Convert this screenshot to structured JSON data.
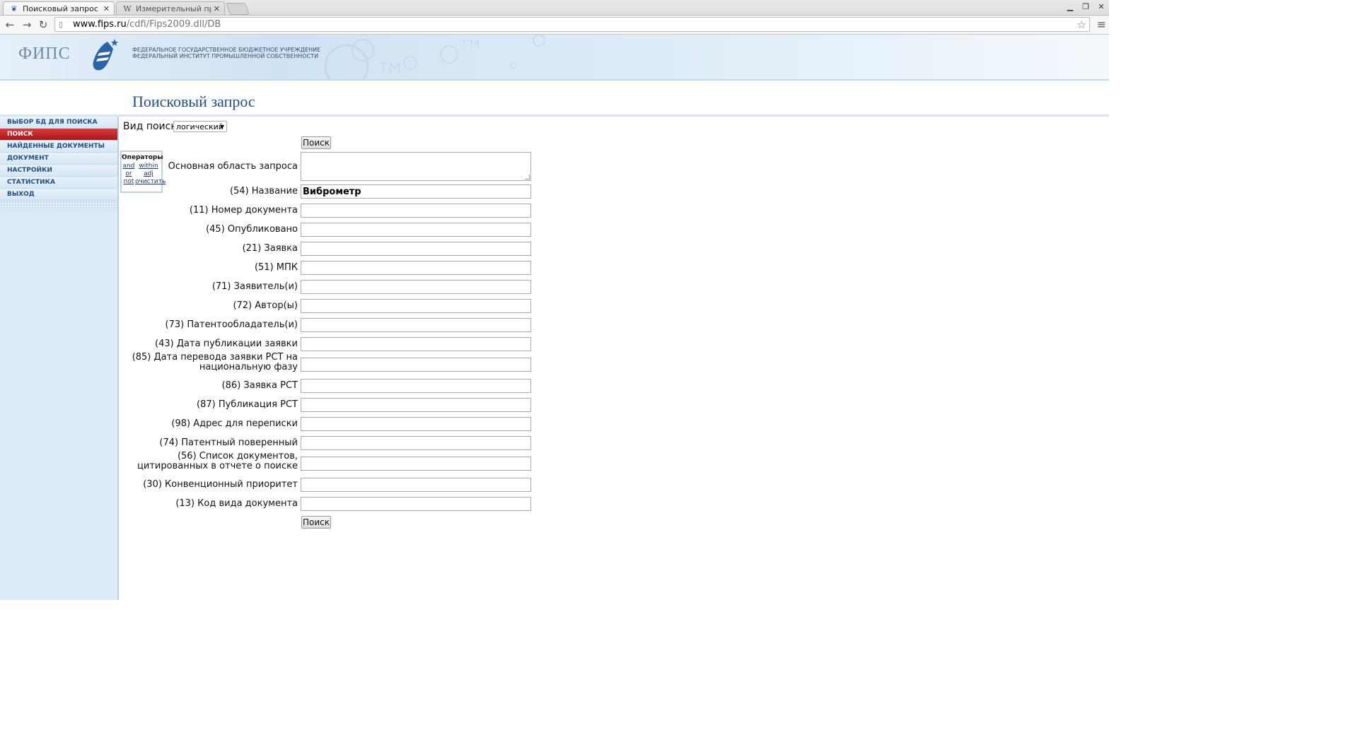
{
  "browser": {
    "tabs": [
      {
        "title": "Поисковый запрос",
        "favicon": "fips-icon",
        "active": true
      },
      {
        "title": "Измерительный прибор",
        "favicon": "W",
        "active": false
      }
    ],
    "url_host": "www.fips.ru",
    "url_path": "/cdfi/Fips2009.dll/DB"
  },
  "header": {
    "logo_text": "ФИПС",
    "org_line1": "ФЕДЕРАЛЬНОЕ ГОСУДАРСТВЕННОЕ БЮДЖЕТНОЕ УЧРЕЖДЕНИЕ",
    "org_line2": "ФЕДЕРАЛЬНЫЙ ИНСТИТУТ ПРОМЫШЛЕННОЙ СОБСТВЕННОСТИ",
    "page_title": "Поисковый запрос"
  },
  "sidebar": {
    "items": [
      {
        "label": "ВЫБОР БД ДЛЯ ПОИСКА",
        "active": false
      },
      {
        "label": "ПОИСК",
        "active": true
      },
      {
        "label": "НАЙДЕННЫЕ ДОКУМЕНТЫ",
        "active": false
      },
      {
        "label": "ДОКУМЕНТ",
        "active": false
      },
      {
        "label": "НАСТРОЙКИ",
        "active": false
      },
      {
        "label": "СТАТИСТИКА",
        "active": false
      },
      {
        "label": "ВЫХОД",
        "active": false
      }
    ]
  },
  "search": {
    "type_label": "Вид поиска",
    "type_value": "логический",
    "button_label": "Поиск",
    "operators": {
      "title": "Операторы",
      "items": [
        "and",
        "within",
        "or",
        "adj",
        "not",
        "очистить"
      ]
    },
    "main_area_label": "Основная область запроса",
    "fields": [
      {
        "label": "(54) Название",
        "value": "Виброметр"
      },
      {
        "label": "(11) Номер документа",
        "value": ""
      },
      {
        "label": "(45) Опубликовано",
        "value": ""
      },
      {
        "label": "(21) Заявка",
        "value": ""
      },
      {
        "label": "(51) МПК",
        "value": ""
      },
      {
        "label": "(71) Заявитель(и)",
        "value": ""
      },
      {
        "label": "(72) Автор(ы)",
        "value": ""
      },
      {
        "label": "(73) Патентообладатель(и)",
        "value": ""
      },
      {
        "label": "(43) Дата публикации заявки",
        "value": ""
      },
      {
        "label": "(85) Дата перевода заявки PCT на национальную фазу",
        "value": ""
      },
      {
        "label": "(86) Заявка PCT",
        "value": ""
      },
      {
        "label": "(87) Публикация PCT",
        "value": ""
      },
      {
        "label": "(98) Адрес для переписки",
        "value": ""
      },
      {
        "label": "(74) Патентный поверенный",
        "value": ""
      },
      {
        "label": "(56) Список документов, цитированных в отчете о поиске",
        "value": ""
      },
      {
        "label": "(30) Конвенционный приоритет",
        "value": ""
      },
      {
        "label": "(13) Код вида документа",
        "value": ""
      }
    ]
  }
}
